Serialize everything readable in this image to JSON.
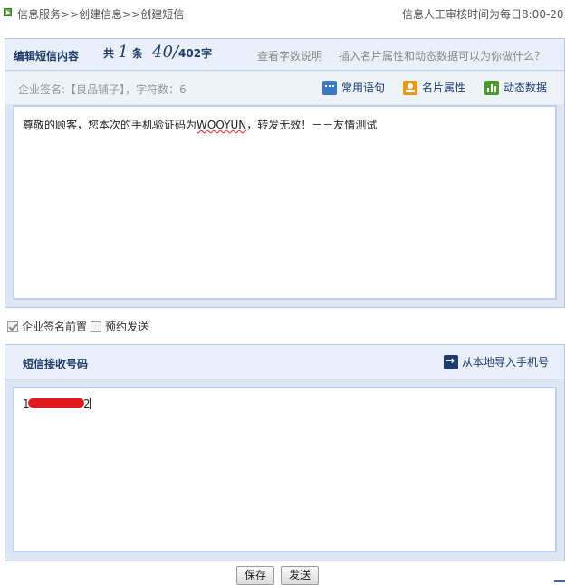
{
  "breadcrumb": "信息服务>>创建信息>>创建短信",
  "review_time": "信息人工审核时间为每日8:00-20",
  "editor": {
    "title": "编辑短信内容",
    "count_prefix": "共",
    "count_messages": "1",
    "count_unit": "条",
    "chars_used": "40",
    "chars_sep": "/",
    "chars_total": "402",
    "chars_unit": "字",
    "word_count_help": "查看字数说明",
    "help_link": "插入名片属性和动态数据可以为你做什么？",
    "signature_label": "企业签名:【良品铺子】，字符数：6",
    "tools": [
      {
        "label": "常用语句",
        "icon": "speech-bubble-icon",
        "color": "#3b78c4"
      },
      {
        "label": "名片属性",
        "icon": "contact-card-icon",
        "color": "#e79a15"
      },
      {
        "label": "动态数据",
        "icon": "bar-chart-icon",
        "color": "#4a9a2e"
      }
    ],
    "message_pre": "尊敬的顾客，您本次的手机验证码为",
    "message_code": "WOOYUN",
    "message_post": "，转发无效！－－友情测试"
  },
  "options": {
    "signature_prefix_label": "企业签名前置",
    "signature_prefix_checked": true,
    "schedule_label": "预约发送",
    "schedule_checked": false
  },
  "recipients": {
    "title": "短信接收号码",
    "import_label": "从本地导入手机号",
    "number_start": "1",
    "number_end": "2"
  },
  "actions": {
    "save_label": "保存",
    "send_label": "发送"
  }
}
